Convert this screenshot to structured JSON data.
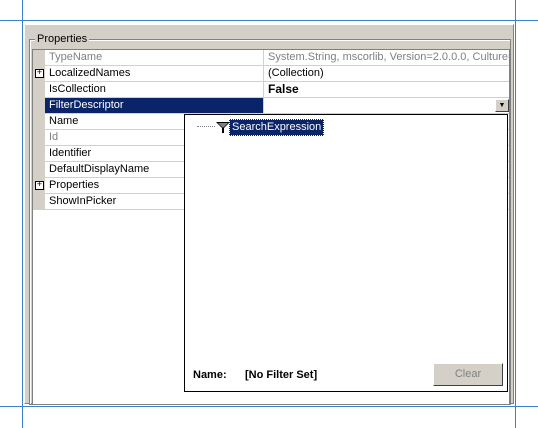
{
  "group": {
    "label": "Properties"
  },
  "properties": [
    {
      "name": "TypeName",
      "value": "System.String, mscorlib, Version=2.0.0.0, Culture=n",
      "expandable": false,
      "dimmed": true
    },
    {
      "name": "LocalizedNames",
      "value": "(Collection)",
      "expandable": true,
      "dimmed": false
    },
    {
      "name": "IsCollection",
      "value": "False",
      "expandable": false,
      "dimmed": false,
      "bold_value": true
    },
    {
      "name": "FilterDescriptor",
      "value": "",
      "expandable": false,
      "dimmed": false,
      "selected": true
    },
    {
      "name": "Name",
      "value": "",
      "expandable": false,
      "dimmed": false
    },
    {
      "name": "Id",
      "value": "",
      "expandable": false,
      "dimmed": true
    },
    {
      "name": "Identifier",
      "value": "",
      "expandable": false,
      "dimmed": false
    },
    {
      "name": "DefaultDisplayName",
      "value": "",
      "expandable": false,
      "dimmed": false
    },
    {
      "name": "Properties",
      "value": "",
      "expandable": true,
      "dimmed": false
    },
    {
      "name": "ShowInPicker",
      "value": "",
      "expandable": false,
      "dimmed": false
    }
  ],
  "expander_glyph": "+",
  "dropdown": {
    "arrow_glyph": "▼",
    "tree_item": {
      "label": "SearchExpression",
      "icon": "filter-icon"
    },
    "footer": {
      "name_label": "Name:",
      "name_value": "[No Filter Set]",
      "clear_label": "Clear"
    }
  },
  "colors": {
    "selection": "#0a246a",
    "panel": "#d4d0c8",
    "guide": "#3a7fd0"
  }
}
